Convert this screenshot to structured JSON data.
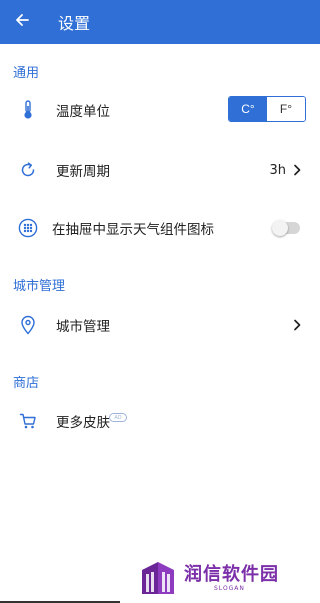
{
  "app_bar": {
    "title": "设置",
    "background_color": "#2f6fd6",
    "back_icon": "arrow-left-icon"
  },
  "sections": {
    "general": {
      "header": "通用",
      "temperature": {
        "label": "温度单位",
        "icon": "thermometer-icon",
        "options": [
          "C°",
          "F°"
        ],
        "selected": "C°"
      },
      "refresh": {
        "label": "更新周期",
        "icon": "refresh-icon",
        "value": "3h"
      },
      "drawer_icon": {
        "label": "在抽屉中显示天气组件图标",
        "icon": "apps-grid-icon",
        "enabled": false
      }
    },
    "city": {
      "header": "城市管理",
      "manage": {
        "label": "城市管理",
        "icon": "location-pin-icon"
      }
    },
    "store": {
      "header": "商店",
      "skins": {
        "label": "更多皮肤",
        "icon": "shopping-cart-icon",
        "badge": "AD"
      }
    }
  },
  "watermark": {
    "text": "润信软件园",
    "slogan": "SLOGAN",
    "color": "#7b2fa8"
  }
}
